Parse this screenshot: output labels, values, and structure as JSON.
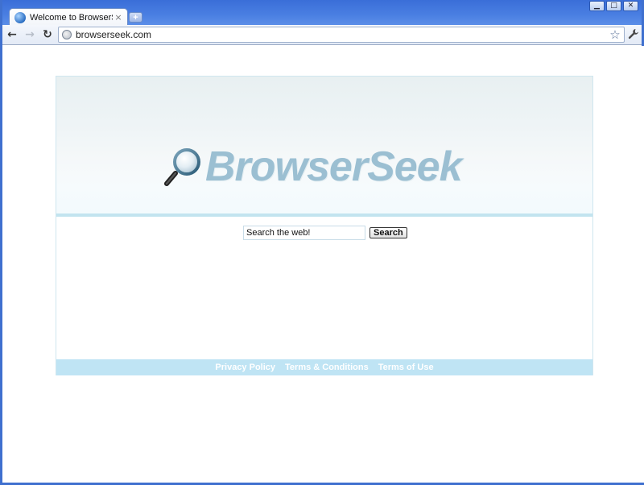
{
  "browser": {
    "tab": {
      "title": "Welcome to BrowserSeek",
      "close_glyph": "×"
    },
    "new_tab_glyph": "+",
    "window_controls": {
      "minimize": "▁",
      "maximize": "□",
      "close": "✕"
    },
    "nav": {
      "back": "←",
      "forward": "→",
      "reload": "↻"
    },
    "url": "browserseek.com",
    "star": "☆",
    "wrench": "🔧"
  },
  "page": {
    "logo_text": "BrowserSeek",
    "search": {
      "value": "Search the web!",
      "button_label": "Search"
    },
    "footer_links": [
      {
        "label": "Privacy Policy"
      },
      {
        "label": "Terms & Conditions"
      },
      {
        "label": "Terms of Use"
      }
    ]
  },
  "colors": {
    "window_frame": "#3f70cf",
    "logo_text": "#9bbfd2",
    "header_rule": "#c2e4ef",
    "footer_band": "#bfe4f4"
  }
}
